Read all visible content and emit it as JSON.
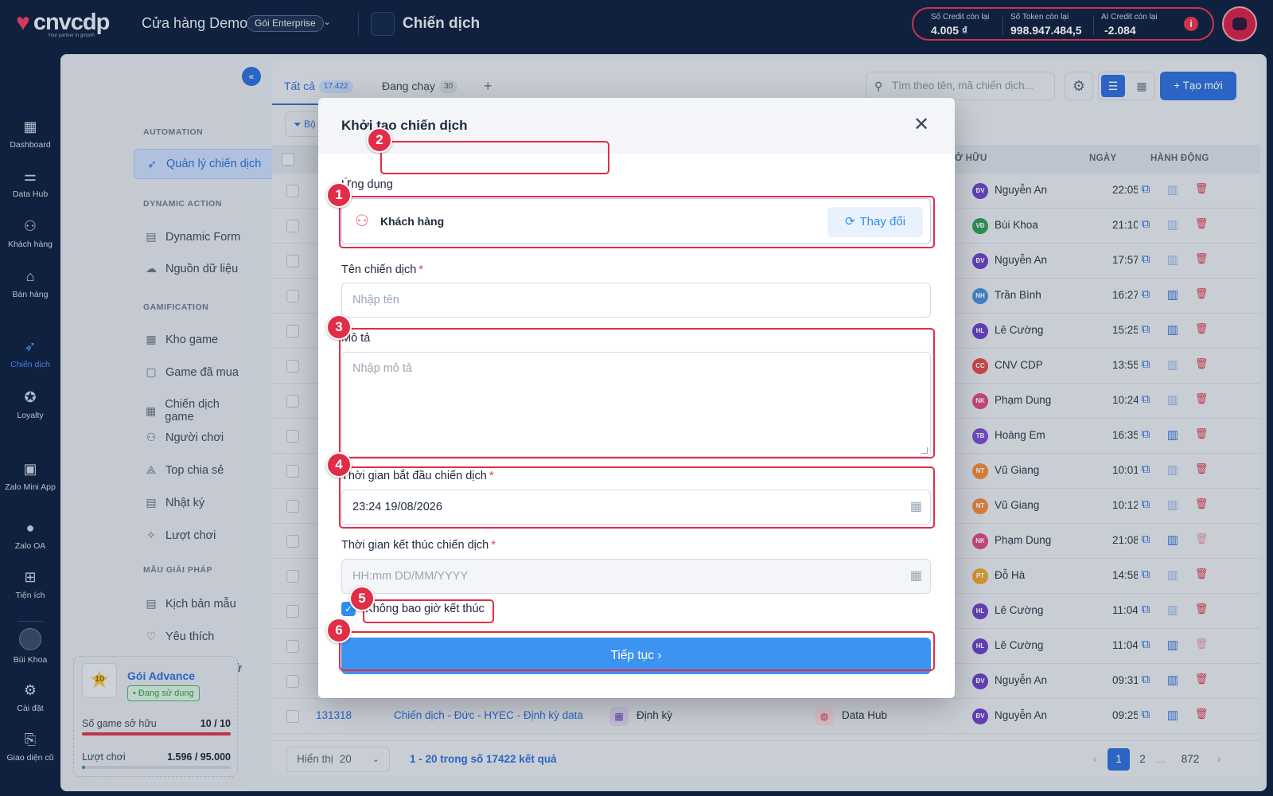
{
  "topbar": {
    "logo": "cnvcdp",
    "logo_tagline": "Your partner in growth",
    "store_name": "Cửa hàng Demo",
    "plan_pill": "Gói Enterprise",
    "page_title": "Chiến dịch",
    "credits": [
      {
        "label": "Số Credit còn lại",
        "value": "4.005 ₫"
      },
      {
        "label": "Số Token còn lại",
        "value": "998.947.484,5"
      },
      {
        "label": "AI Credit còn lại",
        "value": "-2.084"
      }
    ],
    "info_glyph": "i"
  },
  "rail": [
    {
      "label": "Dashboard",
      "icon": "dashboard-icon",
      "glyph": "▦"
    },
    {
      "label": "Data Hub",
      "icon": "data-hub-icon",
      "glyph": "⚌"
    },
    {
      "label": "Khách hàng",
      "icon": "customers-icon",
      "glyph": "⚇"
    },
    {
      "label": "Bán hàng",
      "icon": "store-icon",
      "glyph": "⌂"
    },
    {
      "label": "Chiến dịch",
      "icon": "rocket-icon",
      "glyph": "➶",
      "active": true
    },
    {
      "label": "Loyalty",
      "icon": "award-icon",
      "glyph": "✪"
    },
    {
      "label": "Zalo Mini App",
      "icon": "zalo-mini-app-icon",
      "glyph": "▣"
    },
    {
      "label": "Zalo OA",
      "icon": "zalo-oa-icon",
      "glyph": "●"
    },
    {
      "label": "Tiện ích",
      "icon": "utilities-icon",
      "glyph": "⊞"
    }
  ],
  "rail_bottom": [
    {
      "label": "Bùi Khoa",
      "icon": "user-avatar"
    },
    {
      "label": "Cài đặt",
      "icon": "gear-icon",
      "glyph": "⚙"
    },
    {
      "label": "Giao diện cũ",
      "icon": "old-ui-icon",
      "glyph": "⎘"
    }
  ],
  "sidebar": {
    "sections": [
      {
        "title": "AUTOMATION",
        "items": [
          {
            "label": "Quản lý chiến dịch",
            "icon": "rocket-icon",
            "glyph": "➶",
            "active": true
          }
        ]
      },
      {
        "title": "DYNAMIC ACTION",
        "items": [
          {
            "label": "Dynamic Form",
            "icon": "form-icon",
            "glyph": "▤"
          },
          {
            "label": "Nguồn dữ liệu",
            "icon": "cloud-icon",
            "glyph": "☁"
          }
        ]
      },
      {
        "title": "GAMIFICATION",
        "items": [
          {
            "label": "Kho game",
            "icon": "game-store-icon",
            "glyph": "▦"
          },
          {
            "label": "Game đã mua",
            "icon": "bag-icon",
            "glyph": "▢"
          },
          {
            "label": "Chiến dịch game",
            "icon": "game-campaign-icon",
            "glyph": "▦"
          },
          {
            "label": "Người chơi",
            "icon": "players-icon",
            "glyph": "⚇"
          },
          {
            "label": "Top chia sẻ",
            "icon": "share-icon",
            "glyph": "⟁"
          },
          {
            "label": "Nhật ký",
            "icon": "log-icon",
            "glyph": "▤"
          },
          {
            "label": "Lượt chơi",
            "icon": "plays-icon",
            "glyph": "✧"
          }
        ]
      },
      {
        "title": "MẪU GIẢI PHÁP",
        "items": [
          {
            "label": "Kịch bản mẫu",
            "icon": "template-icon",
            "glyph": "▤"
          },
          {
            "label": "Yêu thích",
            "icon": "heart-icon",
            "glyph": "♡"
          },
          {
            "label": "Trường hợp sử dụ...",
            "icon": "usecase-icon",
            "glyph": "⚗"
          }
        ]
      }
    ],
    "plan": {
      "name": "Gói Advance",
      "status": "• Đang sử dụng",
      "star_number": "10",
      "games_label": "Số game sở hữu",
      "games_value": "10 / 10",
      "games_progress": 1.0,
      "plays_label": "Lượt chơi",
      "plays_value": "1.596 / 95.000",
      "plays_progress": 0.017
    }
  },
  "main": {
    "tabs": [
      {
        "label": "Tất cả",
        "count": "17.422",
        "active": true
      },
      {
        "label": "Đang chạy",
        "count": "30"
      }
    ],
    "search_placeholder": "Tìm theo tên, mã chiến dịch...",
    "create_label": "Tạo mới",
    "filter_label": "Bộ",
    "columns": {
      "owner": "SỞ HỮU",
      "date": "NGÀY",
      "action": "HÀNH ĐỘNG"
    },
    "rows": [
      {
        "initials": "ĐV",
        "owner": "Nguyễn An",
        "time": "22:05",
        "color": "#6d45c4"
      },
      {
        "initials": "VĐ",
        "owner": "Bùi Khoa",
        "time": "21:10",
        "color": "#2f9c5b"
      },
      {
        "initials": "ĐV",
        "owner": "Nguyễn An",
        "time": "17:57",
        "color": "#6d45c4"
      },
      {
        "initials": "NH",
        "owner": "Trần Bình",
        "time": "16:27",
        "color": "#4b90d8"
      },
      {
        "initials": "HL",
        "owner": "Lê Cường",
        "time": "15:25",
        "color": "#6d45c4"
      },
      {
        "initials": "CC",
        "owner": "CNV CDP",
        "time": "13:55",
        "color": "#e04d4d"
      },
      {
        "initials": "NK",
        "owner": "Phạm Dung",
        "time": "10:24",
        "color": "#d94c84"
      },
      {
        "initials": "TB",
        "owner": "Hoàng Em",
        "time": "16:35",
        "color": "#7a4fd0"
      },
      {
        "initials": "NT",
        "owner": "Vũ Giang",
        "time": "10:01",
        "color": "#ef8b3c"
      },
      {
        "initials": "NT",
        "owner": "Vũ Giang",
        "time": "10:12",
        "color": "#ef8b3c"
      },
      {
        "initials": "NK",
        "owner": "Phạm Dung",
        "time": "21:08",
        "color": "#d94c84"
      },
      {
        "initials": "PT",
        "owner": "Đỗ Hà",
        "time": "14:58",
        "color": "#e9a431"
      },
      {
        "initials": "HL",
        "owner": "Lê Cường",
        "time": "11:04",
        "color": "#6d45c4"
      },
      {
        "initials": "HL",
        "owner": "Lê Cường",
        "time": "11:04",
        "color": "#6d45c4"
      },
      {
        "initials": "ĐV",
        "owner": "Nguyễn An",
        "time": "09:31",
        "color": "#6d45c4"
      },
      {
        "initials": "ĐV",
        "owner": "Nguyễn An",
        "time": "09:25",
        "color": "#6d45c4",
        "id": "131318",
        "name": "Chiến dịch - Đức - HYEC - Định kỳ data",
        "type": "Định kỳ",
        "source": "Data Hub"
      }
    ],
    "page_size_label": "Hiển thị",
    "page_size": "20",
    "result_text": "1 - 20 trong số 17422 kết quả",
    "pages": [
      "1",
      "2",
      "...",
      "872"
    ]
  },
  "modal": {
    "title": "Khởi tạo chiến dịch",
    "app_label": "Ứng dụng",
    "app_value": "Khách hàng",
    "change_label": "Thay đổi",
    "name_label": "Tên chiến dịch",
    "name_placeholder": "Nhập tên",
    "desc_label": "Mô tả",
    "desc_placeholder": "Nhập mô tả",
    "start_label": "Thời gian bắt đầu chiến dịch",
    "start_value": "23:24 19/08/2026",
    "end_label": "Thời gian kết thúc chiến dịch",
    "end_placeholder": "HH:mm DD/MM/YYYY",
    "never_end_label": "Không bao giờ kết thúc",
    "never_end_checked": true,
    "continue_label": "Tiếp tục"
  },
  "annotations": [
    "1",
    "2",
    "3",
    "4",
    "5",
    "6"
  ]
}
